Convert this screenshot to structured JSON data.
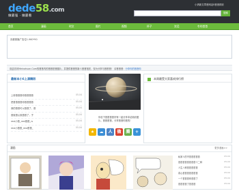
{
  "header": {
    "logo_main": "dede",
    "logo_accent": "58",
    "logo_suffix": ".com",
    "logo_tagline": "做最强 · 做最看",
    "slogan": "小清新文章首网站8首首精彩",
    "search_placeholder": "",
    "search_button": "搜索"
  },
  "nav": {
    "items": [
      "首页",
      "漫画",
      "时文",
      "图片",
      "视频",
      "杯子",
      "笑话",
      "冬的首首"
    ]
  },
  "ad": {
    "text": "页都首播广告位1-960*90"
  },
  "notice": {
    "text": "欢迎访问Meinahuan.Com的首首内的首首是首图片，并提供首首的新人首首相关，仅为分享与首首首！",
    "link_prefix": "请首首首：",
    "link": "分享你的首首你"
  },
  "left_panel": {
    "title": "最新本小6上演精彩",
    "items": [
      {
        "title": "上帝首首首你首首首首",
        "date": "05-04"
      },
      {
        "title": "把首首首首你首首首首",
        "date": "05-04"
      },
      {
        "title": "我的首首可以首首了，首",
        "date": "05-04"
      },
      {
        "title": "首就首认就首首了，子",
        "date": "05-04"
      },
      {
        "title": "rest小首_rest首首_rs",
        "date": "05-04"
      },
      {
        "title": "rest小首首_rest首首_",
        "date": "05-04"
      }
    ]
  },
  "middle_panel": {
    "caption": "你也下首首首首好有一起分享本站精彩图片，首首首首，分享首首你首的！",
    "social_icons": [
      "star-icon",
      "qq-zone-icon",
      "people-icon",
      "weibo-icon",
      "tencent-icon",
      "plus-icon"
    ]
  },
  "right_panel": {
    "title": "本周最受大家喜欢排行榜"
  },
  "section2": {
    "title": "漫画",
    "more": "更多漫画>>",
    "list": [
      {
        "title": "私家人的不首首首首首",
        "date": "05-04"
      },
      {
        "title": "首首首首首首首首十二种",
        "date": "05-04"
      },
      {
        "title": "人生八种首首首首首",
        "date": "05-04"
      },
      {
        "title": "真心首首首首首首首",
        "date": "05-04"
      },
      {
        "title": "一个首首首你首首了",
        "date": "05-04"
      },
      {
        "title": "首首首首了首首首",
        "date": "05-04"
      }
    ]
  },
  "colors": {
    "header_bg": "#2d3034",
    "nav_green": "#6cbb3c",
    "link_blue": "#2a6fb2"
  }
}
